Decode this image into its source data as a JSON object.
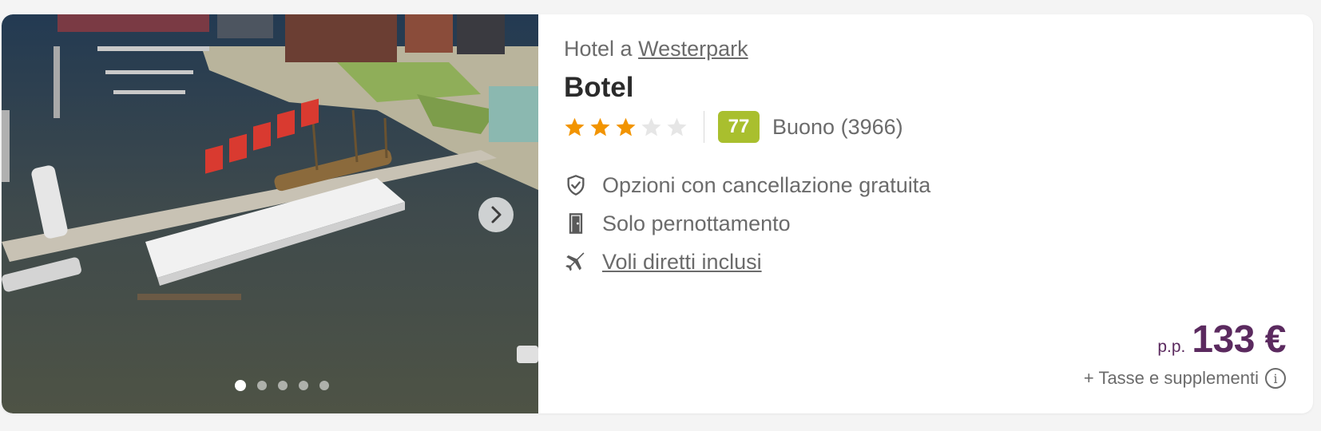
{
  "location": {
    "prefix": "Hotel a",
    "area": "Westerpark"
  },
  "hotel": {
    "name": "Botel",
    "stars": 3,
    "max_stars": 5
  },
  "rating": {
    "score": "77",
    "label": "Buono (3966)"
  },
  "features": [
    {
      "icon": "shield-check-icon",
      "text": "Opzioni con cancellazione gratuita",
      "link": false
    },
    {
      "icon": "door-icon",
      "text": "Solo pernottamento",
      "link": false
    },
    {
      "icon": "airplane-icon",
      "text": "Voli diretti inclusi",
      "link": true
    }
  ],
  "price": {
    "per_person": "p.p.",
    "amount": "133 €",
    "taxes": "+ Tasse e supplementi"
  },
  "gallery": {
    "total_images": 5,
    "active_index": 0,
    "next_icon": "chevron-right-icon",
    "photo_sign_text": "BOTEL"
  },
  "colors": {
    "price": "#5b2a5f",
    "score_bg": "#a9bf2e",
    "star": "#f29400",
    "star_empty": "#e6e6e6"
  }
}
